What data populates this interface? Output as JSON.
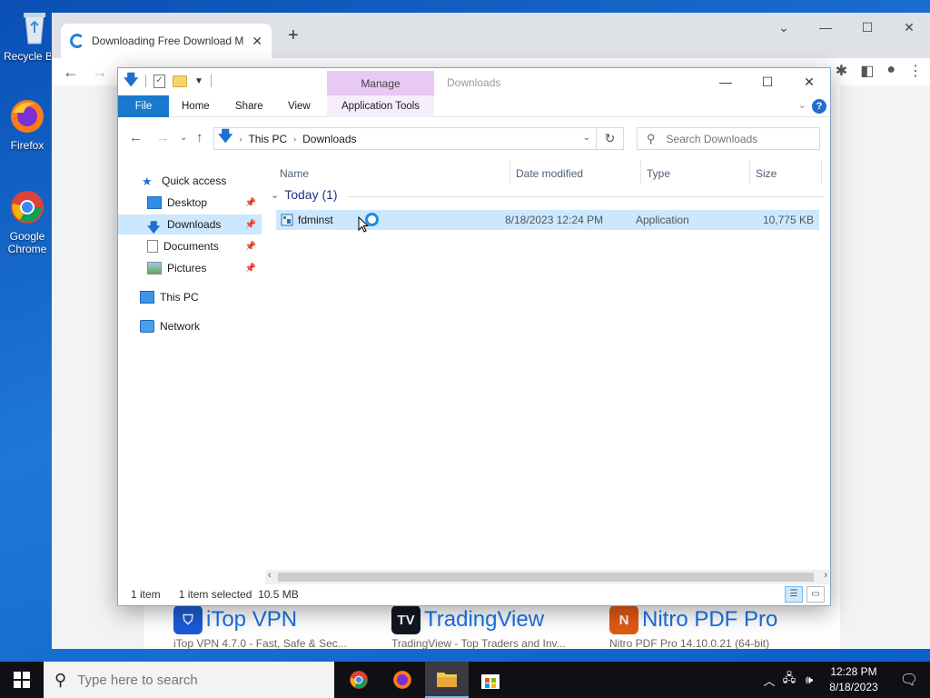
{
  "desktop": {
    "icons": [
      {
        "label": "Recycle Bin"
      },
      {
        "label": "Firefox"
      },
      {
        "label": "Google Chrome"
      }
    ]
  },
  "browser": {
    "tab_title": "Downloading Free Download Ma",
    "tab_close": "✕",
    "new_tab": "+",
    "cards": [
      {
        "name": "iTop VPN",
        "sub": "iTop VPN 4.7.0 - Fast, Safe & Sec...",
        "color": "#1a5bd6"
      },
      {
        "name": "TradingView",
        "sub": "TradingView - Top Traders and Inv...",
        "color": "#131722"
      },
      {
        "name": "Nitro PDF Pro",
        "sub": "Nitro PDF Pro 14.10.0.21 (64-bit)",
        "color": "#e25a12"
      }
    ]
  },
  "explorer": {
    "manage_label": "Manage",
    "window_title": "Downloads",
    "ribbon_tabs": {
      "file": "File",
      "home": "Home",
      "share": "Share",
      "view": "View",
      "app_tools": "Application Tools"
    },
    "breadcrumb": {
      "root": "This PC",
      "current": "Downloads"
    },
    "search_placeholder": "Search Downloads",
    "nav": {
      "quick_access": "Quick access",
      "desktop": "Desktop",
      "downloads": "Downloads",
      "documents": "Documents",
      "pictures": "Pictures",
      "this_pc": "This PC",
      "network": "Network"
    },
    "columns": {
      "name": "Name",
      "date": "Date modified",
      "type": "Type",
      "size": "Size"
    },
    "group_label": "Today (1)",
    "files": [
      {
        "name": "fdminst",
        "date": "8/18/2023 12:24 PM",
        "type": "Application",
        "size": "10,775 KB"
      }
    ],
    "status": {
      "count": "1 item",
      "selected": "1 item selected  10.5 MB"
    }
  },
  "taskbar": {
    "search_placeholder": "Type here to search",
    "time": "12:28 PM",
    "date": "8/18/2023"
  },
  "colors": {
    "accent": "#1979ca",
    "selection": "#cce8ff",
    "manage": "#e7c9f3"
  }
}
